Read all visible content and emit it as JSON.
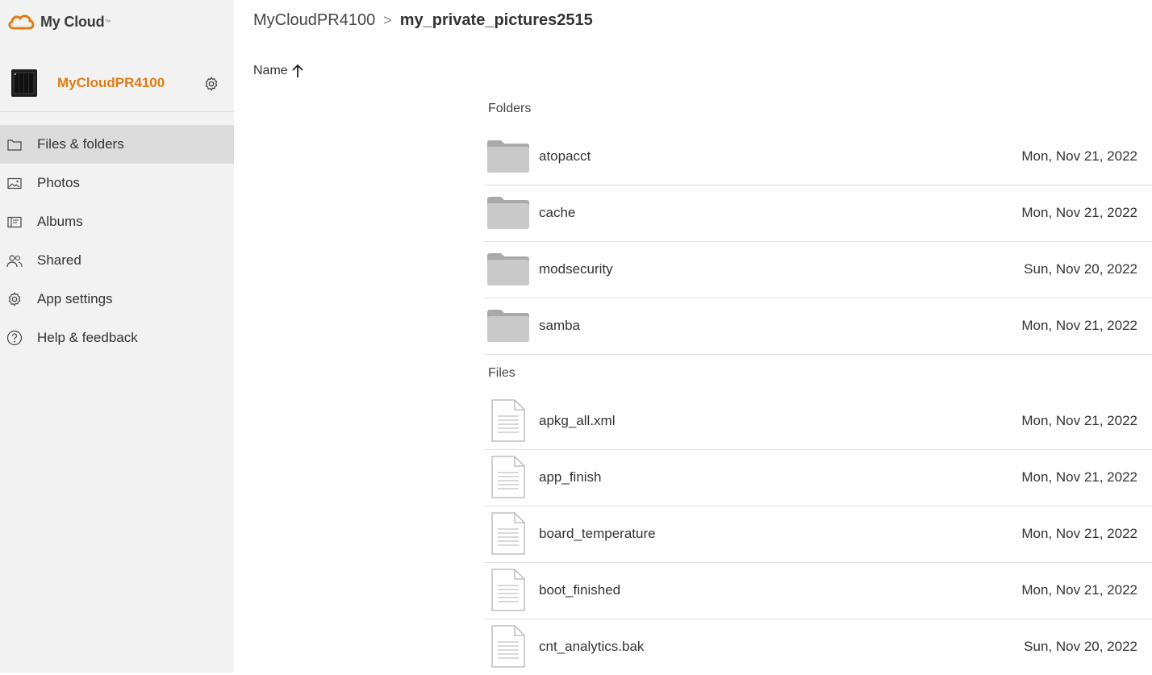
{
  "app": {
    "logo_text": "My Cloud",
    "logo_tm": "™",
    "brand_color": "#e07c14"
  },
  "device": {
    "name": "MyCloudPR4100"
  },
  "sidebar": {
    "items": [
      {
        "label": "Files & folders",
        "icon": "folder-outline-icon",
        "active": true
      },
      {
        "label": "Photos",
        "icon": "photo-icon",
        "active": false
      },
      {
        "label": "Albums",
        "icon": "album-icon",
        "active": false
      },
      {
        "label": "Shared",
        "icon": "people-icon",
        "active": false
      },
      {
        "label": "App settings",
        "icon": "gear-icon",
        "active": false
      },
      {
        "label": "Help & feedback",
        "icon": "help-icon",
        "active": false
      }
    ]
  },
  "breadcrumb": {
    "root": "MyCloudPR4100",
    "separator": ">",
    "current": "my_private_pictures2515"
  },
  "sort": {
    "label": "Name",
    "direction": "ascending"
  },
  "sections": {
    "folders_label": "Folders",
    "files_label": "Files"
  },
  "folders": [
    {
      "name": "atopacct",
      "date": "Mon, Nov 21, 2022"
    },
    {
      "name": "cache",
      "date": "Mon, Nov 21, 2022"
    },
    {
      "name": "modsecurity",
      "date": "Sun, Nov 20, 2022"
    },
    {
      "name": "samba",
      "date": "Mon, Nov 21, 2022"
    }
  ],
  "files": [
    {
      "name": "apkg_all.xml",
      "date": "Mon, Nov 21, 2022"
    },
    {
      "name": "app_finish",
      "date": "Mon, Nov 21, 2022"
    },
    {
      "name": "board_temperature",
      "date": "Mon, Nov 21, 2022"
    },
    {
      "name": "boot_finished",
      "date": "Mon, Nov 21, 2022"
    },
    {
      "name": "cnt_analytics.bak",
      "date": "Sun, Nov 20, 2022"
    }
  ]
}
